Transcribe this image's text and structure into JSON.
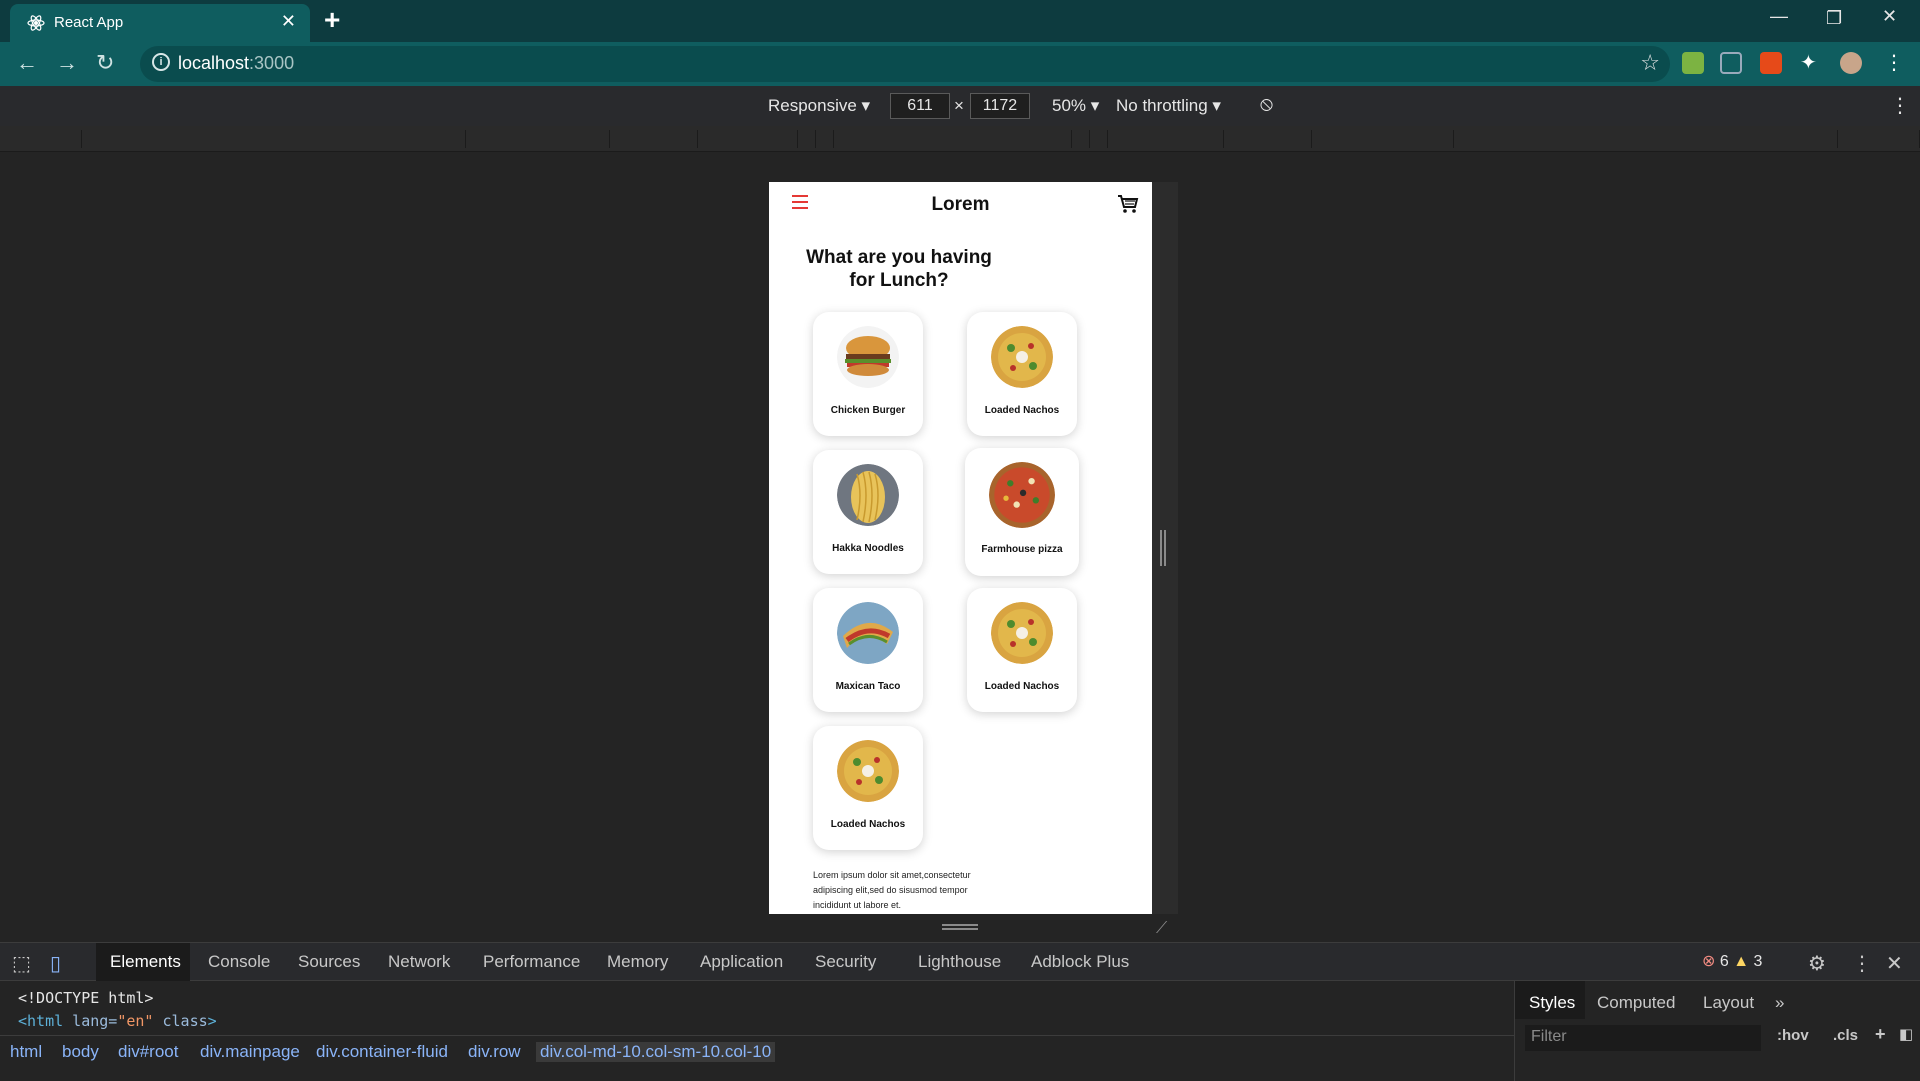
{
  "browser": {
    "tab_title": "React App",
    "url_host": "localhost",
    "url_port": ":3000"
  },
  "device_toolbar": {
    "mode": "Responsive",
    "width": "611",
    "times": "×",
    "height": "1172",
    "zoom": "50%",
    "throttling": "No throttling"
  },
  "app": {
    "brand": "Lorem",
    "heading_line1": "What are you having",
    "heading_line2": "for Lunch?",
    "items": [
      {
        "label": "Chicken Burger"
      },
      {
        "label": "Loaded Nachos"
      },
      {
        "label": "Hakka Noodles"
      },
      {
        "label": "Farmhouse pizza"
      },
      {
        "label": "Maxican Taco"
      },
      {
        "label": "Loaded Nachos"
      },
      {
        "label": "Loaded Nachos"
      }
    ],
    "footer": "Lorem ipsum dolor sit amet,consectetur adipiscing elit,sed do sisusmod tempor incididunt ut labore et."
  },
  "devtools": {
    "tabs": [
      "Elements",
      "Console",
      "Sources",
      "Network",
      "Performance",
      "Memory",
      "Application",
      "Security",
      "Lighthouse",
      "Adblock Plus"
    ],
    "errors": "6",
    "warnings": "3",
    "code_line1": "<!DOCTYPE html>",
    "code_line2_tag": "<html",
    "code_line2_attr": " lang=",
    "code_line2_val": "\"en\"",
    "code_line2_attr2": " class",
    "code_line2_end": ">",
    "breadcrumbs": [
      "html",
      "body",
      "div#root",
      "div.mainpage",
      "div.container-fluid",
      "div.row",
      "div.col-md-10.col-sm-10.col-10"
    ],
    "styles_tabs": [
      "Styles",
      "Computed",
      "Layout"
    ],
    "filter_placeholder": "Filter",
    "hov": ":hov",
    "cls": ".cls"
  },
  "colors": {
    "browser_frame": "#0f5d5f",
    "menu_icon": "#e53935"
  }
}
